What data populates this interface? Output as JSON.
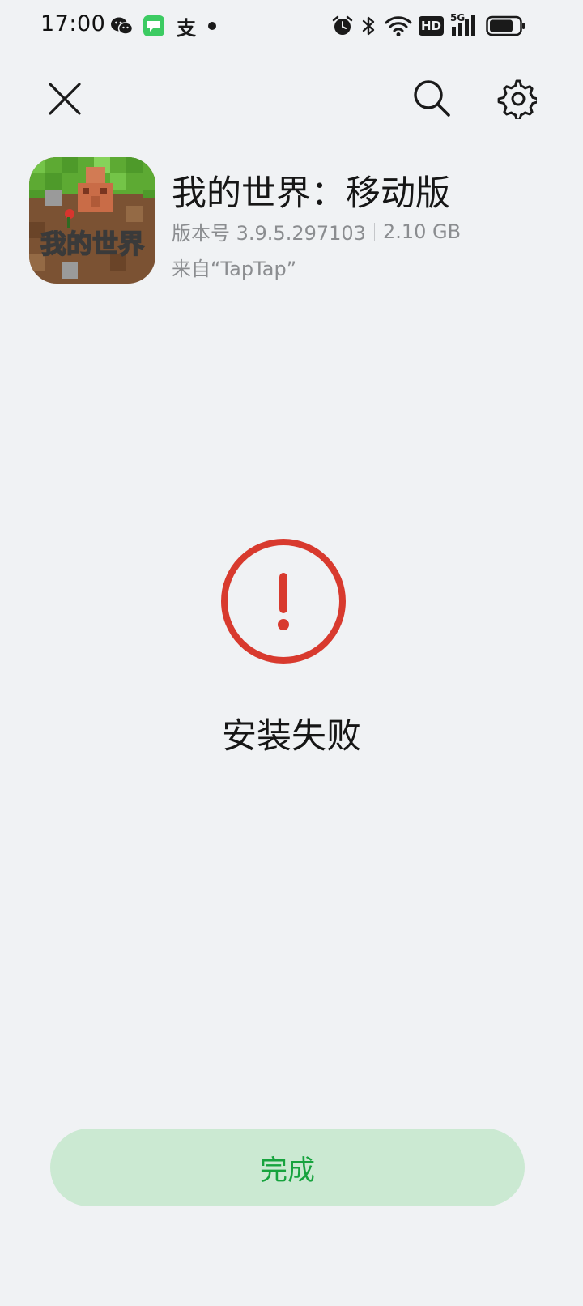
{
  "status_bar": {
    "time": "17:00",
    "left_icons": [
      "wechat-icon",
      "messages-icon",
      "alipay-icon",
      "dot-icon"
    ],
    "right_icons": [
      "alarm-icon",
      "bluetooth-icon",
      "wifi-icon",
      "hd-icon",
      "signal-5g-icon",
      "battery-icon"
    ],
    "hd_label": "HD",
    "network_label": "5G",
    "alipay_glyph": "支"
  },
  "nav": {
    "close_icon": "close-icon",
    "search_icon": "search-icon",
    "settings_icon": "gear-icon"
  },
  "app": {
    "name": "我的世界：移动版",
    "version_label": "版本号 3.9.5.297103",
    "size": "2.10 GB",
    "source": "来自“TapTap”",
    "icon_text": "我的世界"
  },
  "result": {
    "status_text": "安装失败",
    "icon": "warning-circle-icon",
    "color": "#d83a2e"
  },
  "actions": {
    "done_label": "完成",
    "accent": "#17a33e",
    "button_bg": "#cbe9d2"
  }
}
